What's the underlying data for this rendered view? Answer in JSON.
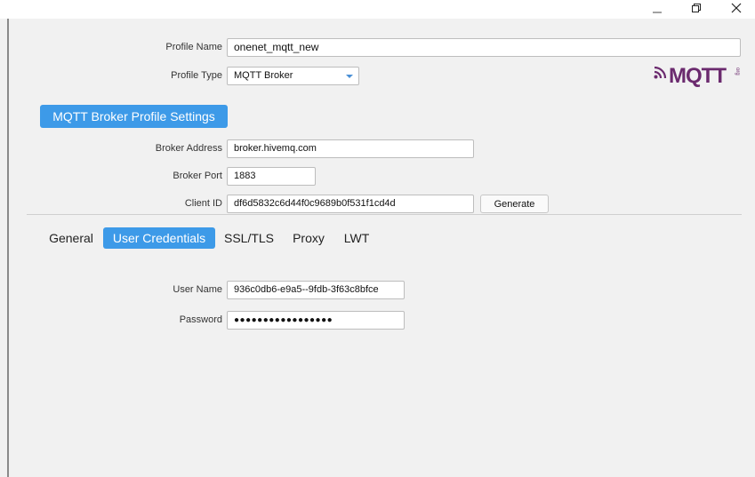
{
  "window": {
    "minimize_icon": "minimize-icon",
    "maximize_icon": "restore-icon",
    "close_icon": "close-icon"
  },
  "profile": {
    "name_label": "Profile Name",
    "name_value": "onenet_mqtt_new",
    "type_label": "Profile Type",
    "type_value": "MQTT Broker"
  },
  "logo": {
    "text": "MQTT",
    "sub_text": "org"
  },
  "broker_section": {
    "title": "MQTT Broker Profile Settings",
    "address_label": "Broker Address",
    "address_value": "broker.hivemq.com",
    "port_label": "Broker Port",
    "port_value": "1883",
    "client_id_label": "Client ID",
    "client_id_value": "df6d5832c6d44f0c9689b0f531f1cd4d",
    "generate_label": "Generate"
  },
  "tabs": [
    {
      "label": "General",
      "active": false
    },
    {
      "label": "User Credentials",
      "active": true
    },
    {
      "label": "SSL/TLS",
      "active": false
    },
    {
      "label": "Proxy",
      "active": false
    },
    {
      "label": "LWT",
      "active": false
    }
  ],
  "credentials": {
    "username_label": "User Name",
    "username_value": "936c0db6-e9a5--9fdb-3f63c8bfce",
    "password_label": "Password",
    "password_value": "●●●●●●●●●●●●●●●●●"
  },
  "colors": {
    "accent": "#3d9ae8",
    "background": "#f1f1f1",
    "logo": "#6b2a6e"
  }
}
